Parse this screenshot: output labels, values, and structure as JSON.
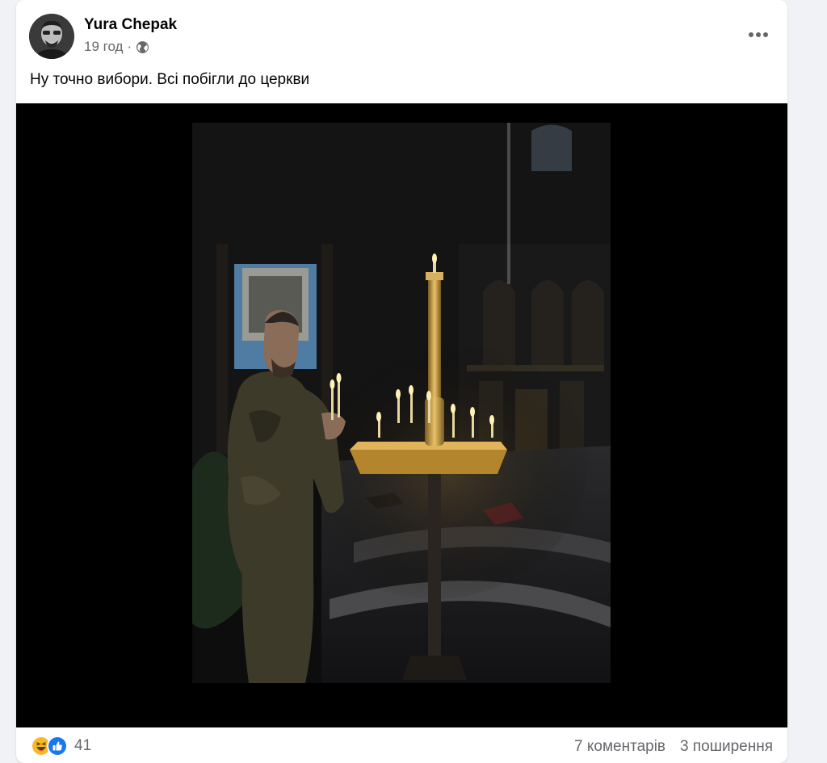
{
  "post": {
    "author": "Yura Chepak",
    "time": "19 год",
    "separator": "·",
    "audience_icon": "globe-icon",
    "text": "Ну точно вибори. Всі побігли до церкви",
    "more_icon": "more-options-icon"
  },
  "footer": {
    "reaction_icons": [
      "haha-icon",
      "like-icon"
    ],
    "reaction_count": "41",
    "comments": "7 коментарів",
    "shares": "3 поширення"
  },
  "colors": {
    "page_bg": "#f0f2f5",
    "card_bg": "#ffffff",
    "text_primary": "#050505",
    "text_secondary": "#65676b",
    "like_blue": "#1877f2",
    "haha_yellow": "#f7b928"
  }
}
